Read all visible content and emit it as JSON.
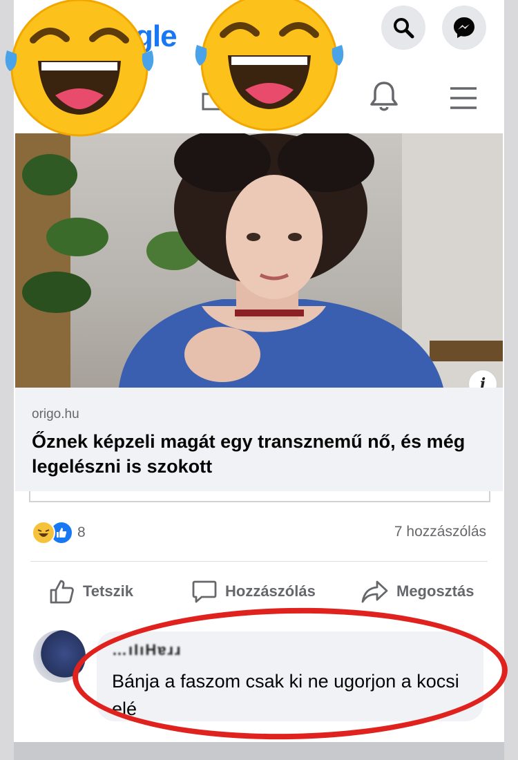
{
  "header": {
    "logo_fragment": "gle",
    "icons": [
      "search-icon",
      "messenger-icon",
      "home-icon",
      "bell-icon",
      "menu-icon"
    ]
  },
  "overlay": {
    "emojis": [
      "laughing-tears-emoji",
      "laughing-tears-emoji"
    ]
  },
  "post": {
    "link": {
      "domain": "origo.hu",
      "title": "Őznek képzeli magát egy transznemű nő, és még legelészni is szokott"
    },
    "info_icon": "i",
    "reactions": {
      "count": "8",
      "types": [
        "haha",
        "like"
      ]
    },
    "comments_count": "7 hozzászólás",
    "actions": {
      "like": "Tetszik",
      "comment": "Hozzászólás",
      "share": "Megosztás"
    }
  },
  "comment": {
    "author": "…ıIıHɐɹɹ",
    "text": "Bánja a faszom csak ki ne ugorjon a kocsi elé"
  },
  "colors": {
    "brand": "#1877f2",
    "highlight_oval": "#e0221f",
    "link_box": "#f0f2f5"
  }
}
